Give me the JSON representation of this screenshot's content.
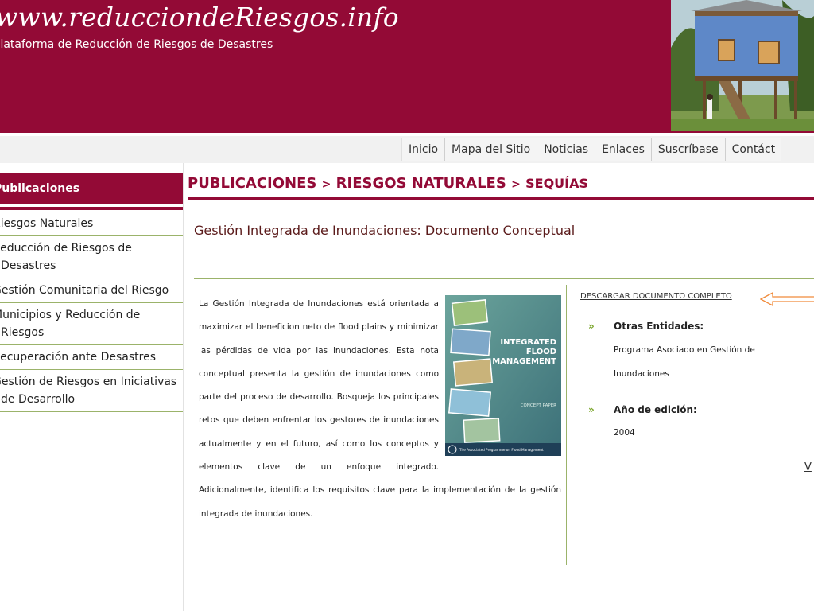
{
  "header": {
    "site_url": "www.reducciondeRiesgos.info",
    "tagline": "Plataforma de Reducción de Riesgos de Desastres",
    "brand_color": "#930a36"
  },
  "topnav": {
    "items": [
      "Inicio",
      "Mapa del Sitio",
      "Noticias",
      "Enlaces",
      "Suscríbase",
      "Contáct"
    ]
  },
  "sidebar": {
    "title": "Publicaciones",
    "items": [
      "Riesgos Naturales",
      "Reducción de Riesgos de Desastres",
      "Gestión Comunitaria del Riesgo",
      "Municipios y Reducción de Riesgos",
      "Recuperación ante Desastres",
      "Gestión de Riesgos en Iniciativas de Desarrollo"
    ]
  },
  "breadcrumb": {
    "level1": "PUBLICACIONES",
    "level2": "RIESGOS NATURALES",
    "level3": "SEQUÍAS",
    "separator": ">"
  },
  "document": {
    "title": "Gestión Integrada de Inundaciones: Documento Conceptual",
    "description": "La Gestión Integrada de Inundaciones está orientada a maximizar el beneficion neto de flood plains y minimizar las pérdidas de vida por las inundaciones. Esta nota conceptual presenta la gestión de inundaciones como parte del proceso de desarrollo. Bosqueja los principales retos que deben enfrentar los gestores de inundaciones actualmente y en el futuro, así como los conceptos y elementos clave de un enfoque integrado. Adicionalmente, identifica los requisitos clave para la implementación de la gestión integrada de inundaciones.",
    "cover": {
      "line1": "INTEGRATED",
      "line2": "FLOOD",
      "line3": "MANAGEMENT",
      "subtitle": "CONCEPT PAPER",
      "footer": "The Associated Programme on Flood Management"
    },
    "download_label": "DESCARGAR DOCUMENTO COMPLETO",
    "other_entities_label": "Otras Entidades:",
    "other_entities_value_line1": "Programa Asociado en Gestión de",
    "other_entities_value_line2": "Inundaciones",
    "year_label": "Año de edición:",
    "year_value": "2004",
    "bullet": "»",
    "more_link": "V"
  }
}
